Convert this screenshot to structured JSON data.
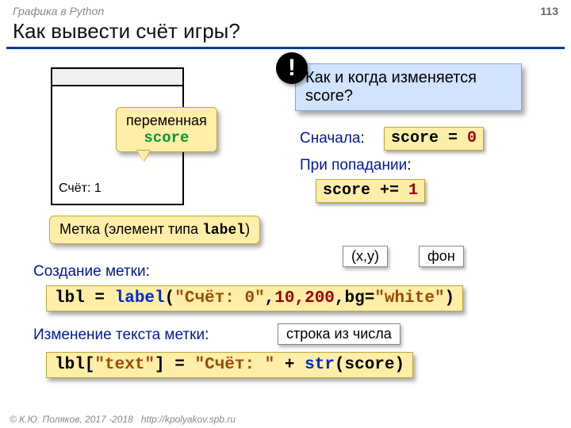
{
  "header": {
    "course": "Графика в Python",
    "page": "113"
  },
  "title": "Как вывести счёт игры?",
  "window": {
    "scoreLabel": "Счёт: 1"
  },
  "varCallout": {
    "line1": "переменная",
    "line2": "score"
  },
  "question": "Как и когда изменяется score?",
  "initLabel": "Сначала",
  "initCode": {
    "a": "score = ",
    "z": "0"
  },
  "hitLabel": "При попадании",
  "hitCode": {
    "a": "score += ",
    "z": "1"
  },
  "labelCallout": {
    "pre": "Метка (элемент типа ",
    "code": "label",
    "post": ")"
  },
  "xy": "(x,y)",
  "bg": "фон",
  "createLabel": "Создание метки",
  "createCode": {
    "a": "lbl = ",
    "fn": "label",
    "p1": "(",
    "s": "\"Счёт: 0\"",
    "c1": ",",
    "xy": "10,200",
    "c2": ",bg=",
    "bgv": "\"white\"",
    "p2": ")"
  },
  "strChip": "строка из числа",
  "changeLabel": "Изменение текста метки",
  "changeCode": {
    "a": "lbl[",
    "key": "\"text\"",
    "b": "] = ",
    "s": "\"Счёт: \"",
    "plus": " + ",
    "str": "str",
    "c": "(score)"
  },
  "footer": {
    "copy": "© К.Ю. Поляков, 2017 -2018",
    "url": "http://kpolyakov.spb.ru"
  }
}
